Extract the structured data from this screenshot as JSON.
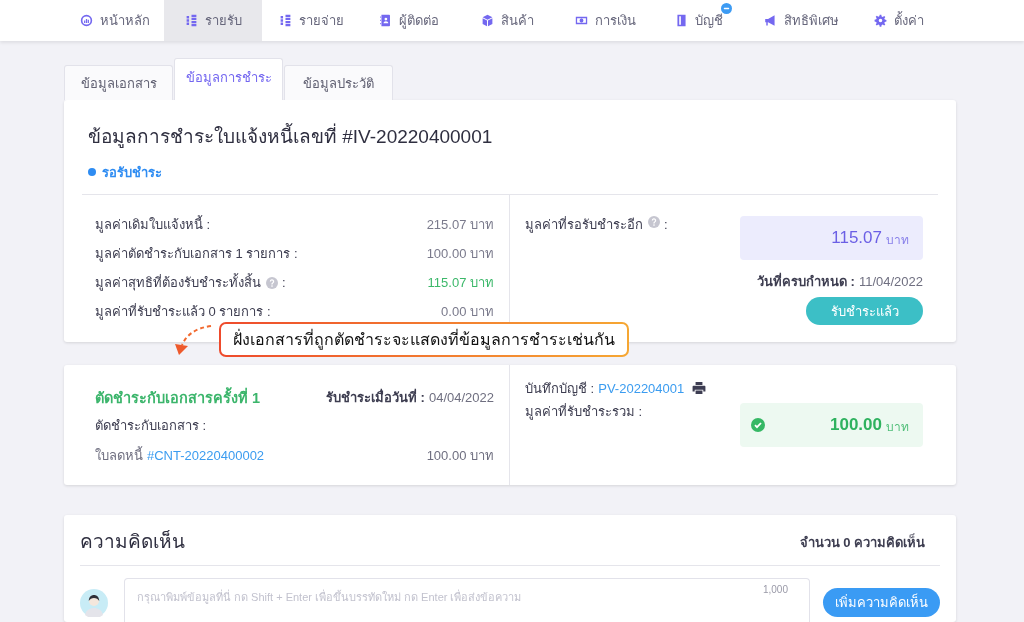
{
  "nav": {
    "items": [
      {
        "label": "หน้าหลัก",
        "selected": false,
        "badge": false
      },
      {
        "label": "รายรับ",
        "selected": true,
        "badge": false
      },
      {
        "label": "รายจ่าย",
        "selected": false,
        "badge": false
      },
      {
        "label": "ผู้ติดต่อ",
        "selected": false,
        "badge": false
      },
      {
        "label": "สินค้า",
        "selected": false,
        "badge": false
      },
      {
        "label": "การเงิน",
        "selected": false,
        "badge": false
      },
      {
        "label": "บัญชี",
        "selected": false,
        "badge": true
      },
      {
        "label": "สิทธิพิเศษ",
        "selected": false,
        "badge": false
      },
      {
        "label": "ตั้งค่า",
        "selected": false,
        "badge": false
      }
    ]
  },
  "tabs": [
    {
      "label": "ข้อมูลเอกสาร",
      "selected": false
    },
    {
      "label": "ข้อมูลการชำระ",
      "selected": true
    },
    {
      "label": "ข้อมูลประวัติ",
      "selected": false
    }
  ],
  "payment": {
    "title": "ข้อมูลการชำระใบแจ้งหนี้เลขที่ #IV-20220400001",
    "status": "รอรับชำระ",
    "rows": [
      {
        "label": "มูลค่าเดิมใบแจ้งหนี้ :",
        "info": false,
        "value": "215.07 บาท",
        "highlight": false
      },
      {
        "label": "มูลค่าตัดชำระกับเอกสาร 1 รายการ :",
        "info": false,
        "value": "100.00 บาท",
        "highlight": false
      },
      {
        "label": "มูลค่าสุทธิที่ต้องรับชำระทั้งสิ้น",
        "info": true,
        "label_end": ":",
        "value": "115.07 บาท",
        "highlight": true
      },
      {
        "label": "มูลค่าที่รับชำระแล้ว 0 รายการ :",
        "info": false,
        "value": "0.00 บาท",
        "highlight": false
      }
    ],
    "outstanding": {
      "label": "มูลค่าที่รอรับชำระอีก",
      "info": true,
      "label_end": ":",
      "amount": "115.07",
      "unit": "บาท"
    },
    "due": {
      "label": "วันที่ครบกำหนด :",
      "value": "11/04/2022"
    },
    "button": "รับชำระแล้ว"
  },
  "callout": {
    "text": "ฝั่งเอกสารที่ถูกตัดชำระจะแสดงที่ข้อมูลการชำระเช่นกัน"
  },
  "settlement": {
    "title": "ตัดชำระกับเอกสารครั้งที่ 1",
    "date_label": "รับชำระเมื่อวันที่ :",
    "date": "04/04/2022",
    "documents_label": "ตัดชำระกับเอกสาร :",
    "documents": [
      {
        "type": "ใบลดหนี้",
        "number": "#CNT-20220400002",
        "amount": "100.00 บาท"
      }
    ],
    "journal_label": "บันทึกบัญชี :",
    "journal": "PV-202204001",
    "total_label": "มูลค่าที่รับชำระรวม :",
    "total": "100.00",
    "unit": "บาท"
  },
  "comments": {
    "title": "ความคิดเห็น",
    "count": "จำนวน 0 ความคิดเห็น",
    "placeholder": "กรุณาพิมพ์ข้อมูลที่นี่ กด Shift + Enter เพื่อขึ้นบรรทัดใหม่ กด Enter เพื่อส่งข้อความ",
    "limit": "1,000",
    "button": "เพิ่มความคิดเห็น"
  }
}
